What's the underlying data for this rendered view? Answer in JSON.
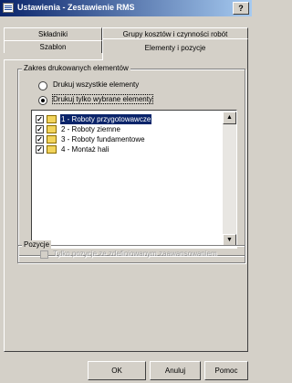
{
  "window": {
    "title": "Ustawienia - Zestawienie RMS",
    "help_label": "?"
  },
  "tabs": {
    "row_back": [
      "Składniki",
      "Grupy kosztów i czynności robót"
    ],
    "row_front": [
      "Szablon",
      "Elementy i pozycje"
    ],
    "active": "Elementy i pozycje"
  },
  "range_group": {
    "title": "Zakres drukowanych elementów",
    "options": [
      {
        "label": "Drukuj wszystkie elementy",
        "selected": false
      },
      {
        "label": "Drukuj tylko wybrane elementy",
        "selected": true
      }
    ]
  },
  "elements_list": {
    "items": [
      {
        "label": "1 - Roboty przygotowawcze",
        "checked": true,
        "selected": true
      },
      {
        "label": "2 - Roboty ziemne",
        "checked": true,
        "selected": false
      },
      {
        "label": "3 - Roboty fundamentowe",
        "checked": true,
        "selected": false
      },
      {
        "label": "4 - Montaż hali",
        "checked": true,
        "selected": false
      }
    ]
  },
  "positions_group": {
    "title": "Pozycje",
    "checkbox_label": "Tylko pozycje ze zdefiniowanym zaawansowaniem",
    "checked": false,
    "enabled": false
  },
  "buttons": {
    "ok": "OK",
    "cancel": "Anuluj",
    "help": "Pomoc"
  },
  "colors": {
    "title_bar": "#0a246a",
    "selection": "#0a246a",
    "face": "#d4d0c8"
  },
  "icons": {
    "window": "window-app-icon",
    "list_item": "folder-icon",
    "scroll_up": "arrow-up-icon",
    "scroll_down": "arrow-down-icon"
  }
}
